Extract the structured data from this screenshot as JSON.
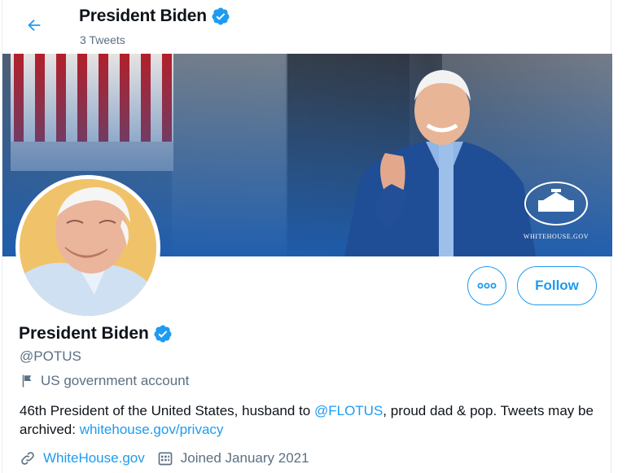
{
  "header": {
    "back_icon": "arrow-left-icon",
    "name": "President Biden",
    "tweet_count": "3 Tweets"
  },
  "banner": {
    "watermark": "WHITEHOUSE.GOV"
  },
  "actions": {
    "more_icon": "more-dots-icon",
    "follow_label": "Follow"
  },
  "profile": {
    "name": "President Biden",
    "handle": "@POTUS",
    "account_label": "US government account",
    "bio": {
      "part1": "46th President of the United States, husband to ",
      "mention": "@FLOTUS",
      "part2": ", proud dad & pop. Tweets may be archived: ",
      "link": "whitehouse.gov/privacy"
    },
    "website": "WhiteHouse.gov",
    "joined": "Joined January 2021"
  },
  "colors": {
    "accent": "#1d9bf0",
    "secondary_text": "#5b7083",
    "primary_text": "#0f1419"
  }
}
